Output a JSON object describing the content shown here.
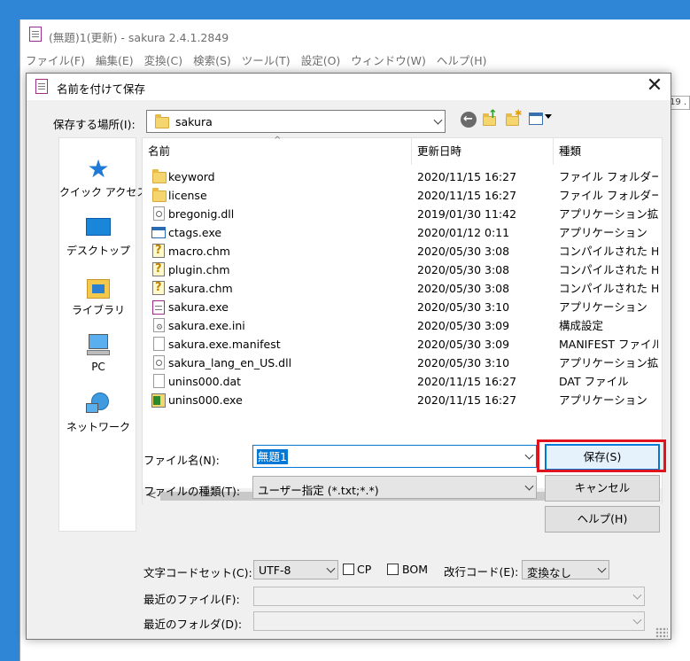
{
  "app": {
    "title": "(無題)1(更新) - sakura 2.4.1.2849",
    "menu": [
      "ファイル(F)",
      "編集(E)",
      "変換(C)",
      "検索(S)",
      "ツール(T)",
      "設定(O)",
      "ウィンドウ(W)",
      "ヘルプ(H)"
    ],
    "clipped_text": "19 ."
  },
  "dialog": {
    "title": "名前を付けて保存",
    "close_glyph": "✕",
    "location_label": "保存する場所(I):",
    "location_value": "sakura",
    "places": [
      {
        "label": "クイック アクセス",
        "icon": "quick-access-icon"
      },
      {
        "label": "デスクトップ",
        "icon": "desktop-icon"
      },
      {
        "label": "ライブラリ",
        "icon": "library-icon"
      },
      {
        "label": "PC",
        "icon": "pc-icon"
      },
      {
        "label": "ネットワーク",
        "icon": "network-icon"
      }
    ],
    "columns": {
      "name": "名前",
      "date": "更新日時",
      "type": "種類"
    },
    "files": [
      {
        "name": "keyword",
        "date": "2020/11/15 16:27",
        "type": "ファイル フォルダー",
        "icon": "folder"
      },
      {
        "name": "license",
        "date": "2020/11/15 16:27",
        "type": "ファイル フォルダー",
        "icon": "folder"
      },
      {
        "name": "bregonig.dll",
        "date": "2019/01/30 11:42",
        "type": "アプリケーション拡張",
        "icon": "dll"
      },
      {
        "name": "ctags.exe",
        "date": "2020/01/12 0:11",
        "type": "アプリケーション",
        "icon": "exe"
      },
      {
        "name": "macro.chm",
        "date": "2020/05/30 3:08",
        "type": "コンパイルされた HT...",
        "icon": "chm"
      },
      {
        "name": "plugin.chm",
        "date": "2020/05/30 3:08",
        "type": "コンパイルされた HT...",
        "icon": "chm"
      },
      {
        "name": "sakura.chm",
        "date": "2020/05/30 3:08",
        "type": "コンパイルされた HT...",
        "icon": "chm"
      },
      {
        "name": "sakura.exe",
        "date": "2020/05/30 3:10",
        "type": "アプリケーション",
        "icon": "sakura"
      },
      {
        "name": "sakura.exe.ini",
        "date": "2020/05/30 3:09",
        "type": "構成設定",
        "icon": "ini"
      },
      {
        "name": "sakura.exe.manifest",
        "date": "2020/05/30 3:09",
        "type": "MANIFEST ファイル",
        "icon": "doc"
      },
      {
        "name": "sakura_lang_en_US.dll",
        "date": "2020/05/30 3:10",
        "type": "アプリケーション拡張",
        "icon": "dll"
      },
      {
        "name": "unins000.dat",
        "date": "2020/11/15 16:27",
        "type": "DAT ファイル",
        "icon": "doc"
      },
      {
        "name": "unins000.exe",
        "date": "2020/11/15 16:27",
        "type": "アプリケーション",
        "icon": "setup"
      }
    ],
    "filename_label": "ファイル名(N):",
    "filename_value": "無題1",
    "filetype_label": "ファイルの種類(T):",
    "filetype_value": "ユーザー指定 (*.txt;*.*)",
    "save_button": "保存(S)",
    "cancel_button": "キャンセル",
    "help_button": "ヘルプ(H)",
    "charset_label": "文字コードセット(C):",
    "charset_value": "UTF-8",
    "cp_label": "CP",
    "bom_label": "BOM",
    "eol_label": "改行コード(E):",
    "eol_value": "変換なし",
    "recent_file_label": "最近のファイル(F):",
    "recent_folder_label": "最近のフォルダ(D):",
    "scroll_left": "<",
    "scroll_right": ">",
    "sort_arrow": "^"
  }
}
